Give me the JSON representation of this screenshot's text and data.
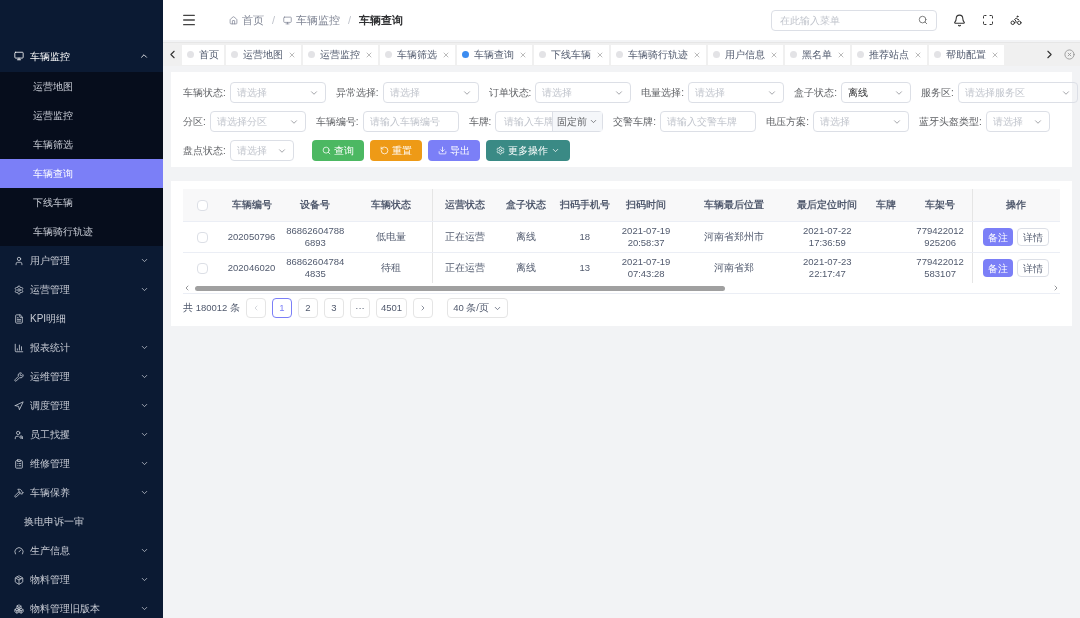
{
  "header": {
    "breadcrumb": [
      {
        "label": "首页",
        "current": false
      },
      {
        "label": "车辆监控",
        "current": false
      },
      {
        "label": "车辆查询",
        "current": true
      }
    ],
    "separator": "/",
    "search": {
      "placeholder": "在此输入菜单"
    }
  },
  "sidebar": {
    "items": [
      {
        "label": "车辆监控",
        "expanded": true,
        "children": [
          {
            "label": "运营地图",
            "selected": false
          },
          {
            "label": "运营监控",
            "selected": false
          },
          {
            "label": "车辆筛选",
            "selected": false
          },
          {
            "label": "车辆查询",
            "selected": true
          },
          {
            "label": "下线车辆",
            "selected": false
          },
          {
            "label": "车辆骑行轨迹",
            "selected": false
          }
        ]
      },
      {
        "label": "用户管理",
        "expanded": false
      },
      {
        "label": "运营管理",
        "expanded": false
      },
      {
        "label": "KPI明细"
      },
      {
        "label": "报表统计",
        "expanded": false
      },
      {
        "label": "运维管理",
        "expanded": false
      },
      {
        "label": "调度管理",
        "expanded": false
      },
      {
        "label": "员工找攫",
        "expanded": false
      },
      {
        "label": "维修管理",
        "expanded": false
      },
      {
        "label": "车辆保养",
        "expanded": false
      },
      {
        "label": "换电申诉一审"
      },
      {
        "label": "生产信息",
        "expanded": false
      },
      {
        "label": "物料管理",
        "expanded": false
      },
      {
        "label": "物料管理旧版本",
        "expanded": false
      }
    ]
  },
  "tabs": [
    {
      "label": "首页",
      "selected": false,
      "closable": false
    },
    {
      "label": "运营地图",
      "selected": false,
      "closable": true
    },
    {
      "label": "运营监控",
      "selected": false,
      "closable": true
    },
    {
      "label": "车辆筛选",
      "selected": false,
      "closable": true
    },
    {
      "label": "车辆查询",
      "selected": true,
      "closable": true
    },
    {
      "label": "下线车辆",
      "selected": false,
      "closable": true
    },
    {
      "label": "车辆骑行轨迹",
      "selected": false,
      "closable": true
    },
    {
      "label": "用户信息",
      "selected": false,
      "closable": true
    },
    {
      "label": "黑名单",
      "selected": false,
      "closable": true
    },
    {
      "label": "推荐站点",
      "selected": false,
      "closable": true
    },
    {
      "label": "帮助配置",
      "selected": false,
      "closable": true
    }
  ],
  "filters": [
    [
      {
        "label": "车辆状态:",
        "kind": "select",
        "placeholder": "请选择"
      },
      {
        "label": "异常选择:",
        "kind": "select",
        "placeholder": "请选择"
      },
      {
        "label": "订单状态:",
        "kind": "select",
        "placeholder": "请选择"
      },
      {
        "label": "电量选择:",
        "kind": "select",
        "placeholder": "请选择"
      },
      {
        "label": "盒子状态:",
        "kind": "select",
        "value": "离线"
      },
      {
        "label": "服务区:",
        "kind": "select",
        "placeholder": "请选择服务区"
      }
    ],
    [
      {
        "label": "分区:",
        "kind": "select",
        "placeholder": "请选择分区"
      },
      {
        "label": "车辆编号:",
        "kind": "input",
        "placeholder": "请输入车辆编号"
      },
      {
        "label": "车牌:",
        "kind": "input_suffix",
        "placeholder": "请输入车牌",
        "suffix": "固定前"
      },
      {
        "label": "交警车牌:",
        "kind": "input",
        "placeholder": "请输入交警车牌"
      },
      {
        "label": "电压方案:",
        "kind": "select",
        "placeholder": "请选择"
      },
      {
        "label": "蓝牙头盔类型:",
        "kind": "select",
        "placeholder": "请选择"
      }
    ],
    [
      {
        "label": "盘点状态:",
        "kind": "select",
        "placeholder": "请选择"
      }
    ]
  ],
  "actions": [
    {
      "label": "查询",
      "kind": "search"
    },
    {
      "label": "重置",
      "kind": "reset"
    },
    {
      "label": "导出",
      "kind": "export"
    },
    {
      "label": "更多操作",
      "kind": "more"
    }
  ],
  "table": {
    "all_checked": false,
    "columns": [
      "车辆编号",
      "设备号",
      "车辆状态",
      "运营状态",
      "盒子状态",
      "扫码手机号",
      "扫码时间",
      "车辆最后位置",
      "最后定位时间",
      "车牌",
      "车架号",
      "操作"
    ],
    "rows": [
      {
        "checked": false,
        "cells": [
          "202050796",
          "86862604788 6893",
          "低电量",
          "正在运营",
          "离线",
          "18",
          "2021-07-19 20:58:37",
          "河南省郑州市",
          "2021-07-22 17:36:59",
          "",
          "779422012 925206"
        ],
        "actions": [
          "备注",
          "详情"
        ]
      },
      {
        "checked": false,
        "cells": [
          "202046020",
          "86862604784 4835",
          "待租",
          "正在运营",
          "离线",
          "13",
          "2021-07-19 07:43:28",
          "河南省郑",
          "2021-07-23 22:17:47",
          "",
          "779422012 583107"
        ],
        "actions": [
          "备注",
          "详情"
        ]
      }
    ]
  },
  "pagination": {
    "total": "共 180012 条",
    "pages": [
      {
        "label": "1",
        "selected": true
      },
      {
        "label": "2",
        "selected": false
      },
      {
        "label": "3",
        "selected": false
      },
      {
        "label": "···",
        "selected": false
      },
      {
        "label": "4501",
        "selected": false
      }
    ],
    "page_size": "40 条/页"
  }
}
